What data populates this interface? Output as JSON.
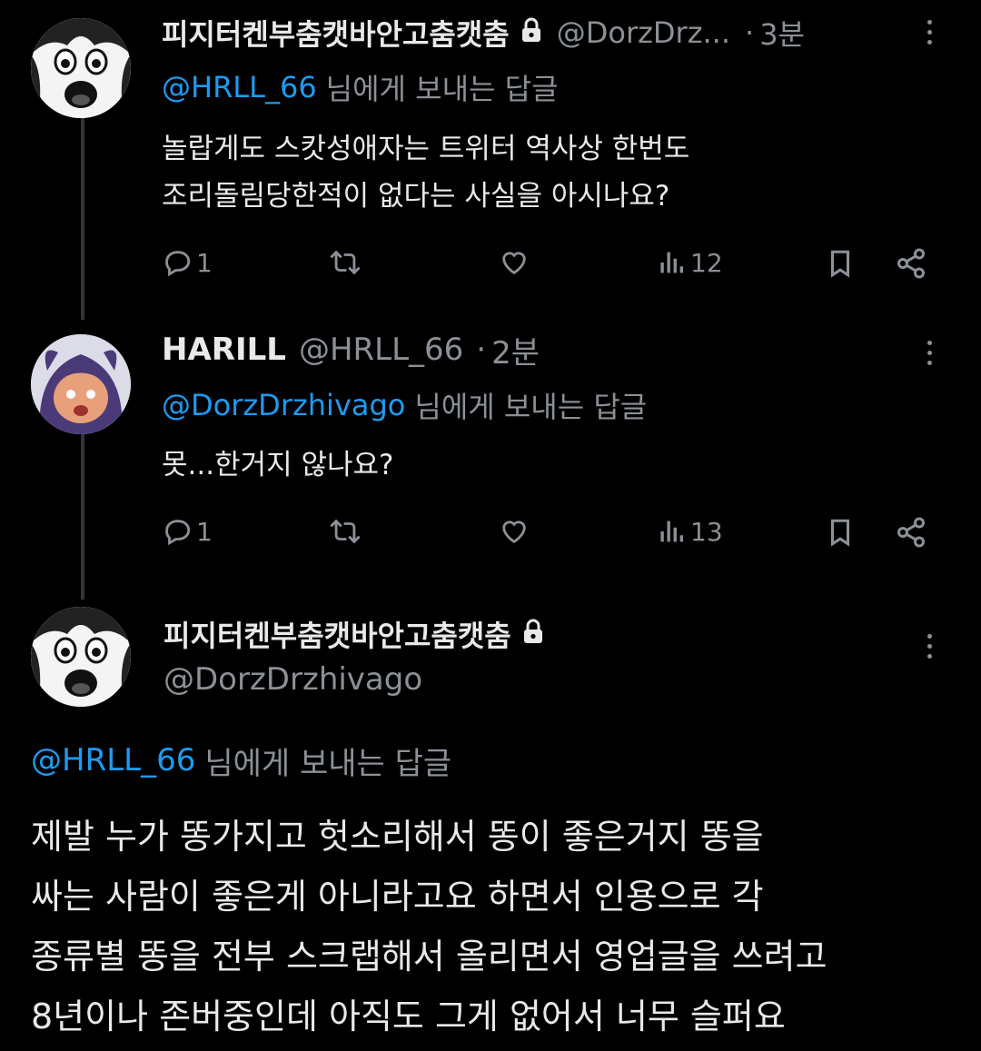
{
  "tweet1": {
    "display_name": "피지터켄부춤캣바안고춤캣춤",
    "handle": "@DorzDrz...",
    "sep": "·",
    "time": "3분",
    "reply_to_handle": "@HRLL_66",
    "reply_to_suffix": "님에게 보내는 답글",
    "text_lines": [
      "놀랍게도 스캇성애자는 트위터 역사상 한번도",
      "조리돌림당한적이 없다는 사실을 아시나요?"
    ],
    "replies": "1",
    "views": "12"
  },
  "tweet2": {
    "display_name": "HARILL",
    "handle": "@HRLL_66",
    "sep": "·",
    "time": "2분",
    "reply_to_handle": "@DorzDrzhivago",
    "reply_to_suffix": "님에게 보내는 답글",
    "text": "못...한거지 않나요?",
    "replies": "1",
    "views": "13"
  },
  "main": {
    "display_name": "피지터켄부춤캣바안고춤캣춤",
    "handle": "@DorzDrzhivago",
    "reply_to_handle": "@HRLL_66",
    "reply_to_suffix": "님에게 보내는 답글",
    "text_lines": [
      "제발 누가 똥가지고 헛소리해서 똥이 좋은거지 똥을",
      "싸는 사람이 좋은게 아니라고요 하면서 인용으로 각",
      "종류별 똥을 전부 스크랩해서 올리면서 영업글을 쓰려고",
      "8년이나 존버중인데 아직도 그게 없어서 너무 슬퍼요"
    ]
  },
  "icons": {
    "reply": "reply-icon",
    "retweet": "retweet-icon",
    "like": "like-icon",
    "views": "views-icon",
    "bookmark": "bookmark-icon",
    "share": "share-icon",
    "more": "more-icon",
    "lock": "lock-icon"
  },
  "colors": {
    "background": "#000000",
    "text": "#e7e9ea",
    "muted": "#8b9096",
    "link": "#1d9bf0",
    "thread_line": "#333639"
  }
}
